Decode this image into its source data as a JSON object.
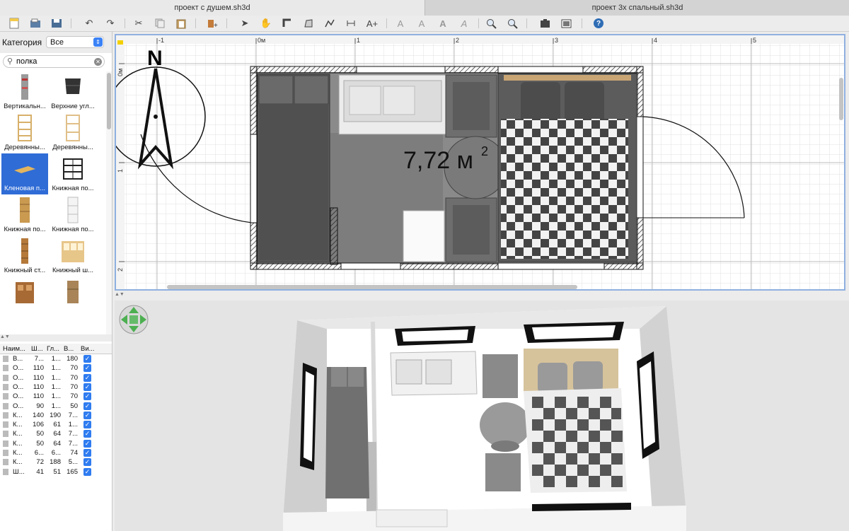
{
  "tabs": [
    {
      "label": "проект с душем.sh3d"
    },
    {
      "label": "проект 3х спальный.sh3d"
    }
  ],
  "toolbar": {
    "icons": [
      "new-icon",
      "open-icon",
      "save-icon",
      "undo-icon",
      "redo-icon",
      "cut-icon",
      "copy-icon",
      "paste-icon",
      "add-furniture-icon",
      "select-icon",
      "pan-icon",
      "create-walls-icon",
      "create-rooms-icon",
      "create-polylines-icon",
      "create-dimensions-icon",
      "add-text-icon",
      "text-style-1-icon",
      "text-style-2-icon",
      "bold-icon",
      "italic-icon",
      "zoom-in-icon",
      "zoom-out-icon",
      "create-photo-icon",
      "create-video-icon",
      "help-icon"
    ]
  },
  "catalog": {
    "category_label": "Категория",
    "category_value": "Все",
    "search_value": "полка",
    "items": [
      {
        "label": "Вертикальн...",
        "selected": false
      },
      {
        "label": "Верхние угл...",
        "selected": false
      },
      {
        "label": "Деревянны...",
        "selected": false
      },
      {
        "label": "Деревянны...",
        "selected": false
      },
      {
        "label": "Кленовая п...",
        "selected": true
      },
      {
        "label": "Книжная по...",
        "selected": false
      },
      {
        "label": "Книжная по...",
        "selected": false
      },
      {
        "label": "Книжная по...",
        "selected": false
      },
      {
        "label": "Книжный ст...",
        "selected": false
      },
      {
        "label": "Книжный ш...",
        "selected": false
      },
      {
        "label": "",
        "selected": false
      },
      {
        "label": "",
        "selected": false
      }
    ]
  },
  "furniture_table": {
    "headers": [
      "Наим...",
      "Ш...",
      "Гл...",
      "В...",
      "Ви..."
    ],
    "rows": [
      {
        "name": "В...",
        "w": "7...",
        "d": "1...",
        "h": "180",
        "visible": true
      },
      {
        "name": "О...",
        "w": "110",
        "d": "1...",
        "h": "70",
        "visible": true
      },
      {
        "name": "О...",
        "w": "110",
        "d": "1...",
        "h": "70",
        "visible": true
      },
      {
        "name": "О...",
        "w": "110",
        "d": "1...",
        "h": "70",
        "visible": true
      },
      {
        "name": "О...",
        "w": "110",
        "d": "1...",
        "h": "70",
        "visible": true
      },
      {
        "name": "О...",
        "w": "90",
        "d": "1...",
        "h": "50",
        "visible": true
      },
      {
        "name": "К...",
        "w": "140",
        "d": "190",
        "h": "7...",
        "visible": true
      },
      {
        "name": "К...",
        "w": "106",
        "d": "61",
        "h": "1...",
        "visible": true
      },
      {
        "name": "К...",
        "w": "50",
        "d": "64",
        "h": "7...",
        "visible": true
      },
      {
        "name": "К...",
        "w": "50",
        "d": "64",
        "h": "7...",
        "visible": true
      },
      {
        "name": "К...",
        "w": "6...",
        "d": "6...",
        "h": "74",
        "visible": true
      },
      {
        "name": "К...",
        "w": "72",
        "d": "188",
        "h": "5...",
        "visible": true
      },
      {
        "name": "Ш...",
        "w": "41",
        "d": "51",
        "h": "165",
        "visible": true
      }
    ]
  },
  "plan": {
    "ruler_x": [
      "-1",
      "0м",
      "1",
      "2",
      "3",
      "4",
      "5"
    ],
    "ruler_y": [
      "0м",
      "1",
      "2"
    ],
    "compass_label": "N",
    "room_area_value": "7,72 м",
    "room_area_exp": "2"
  },
  "colors": {
    "selection_blue": "#2f6cd6",
    "checkbox_blue": "#2f7cf0",
    "plan_border": "#8fb0e0"
  }
}
